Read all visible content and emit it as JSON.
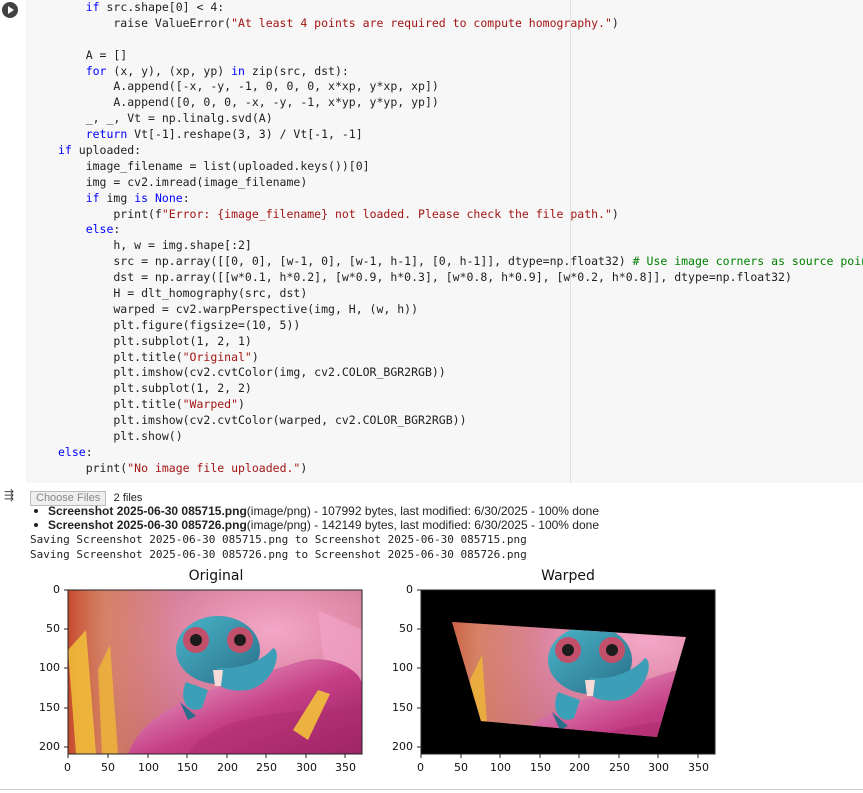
{
  "code_lines": [
    [
      [
        "    ",
        ""
      ],
      [
        "if",
        "k"
      ],
      [
        " src.shape[0] < 4:",
        ""
      ]
    ],
    [
      [
        "        raise ValueError(",
        ""
      ],
      [
        "\"At least 4 points are required to compute homography.\"",
        "s"
      ],
      [
        ")",
        ""
      ]
    ],
    [
      [
        "",
        ""
      ]
    ],
    [
      [
        "    A = []",
        ""
      ]
    ],
    [
      [
        "    ",
        ""
      ],
      [
        "for",
        "k"
      ],
      [
        " (x, y), (xp, yp) ",
        ""
      ],
      [
        "in",
        "k"
      ],
      [
        " zip(src, dst):",
        ""
      ]
    ],
    [
      [
        "        A.append([-x, -y, -1, 0, 0, 0, x*xp, y*xp, xp])",
        ""
      ]
    ],
    [
      [
        "        A.append([0, 0, 0, -x, -y, -1, x*yp, y*yp, yp])",
        ""
      ]
    ],
    [
      [
        "    _, _, Vt = np.linalg.svd(A)",
        ""
      ]
    ],
    [
      [
        "    ",
        ""
      ],
      [
        "return",
        "k"
      ],
      [
        " Vt[-1].reshape(3, 3) / Vt[-1, -1]",
        ""
      ]
    ],
    [
      [
        "if",
        "k"
      ],
      [
        " uploaded:",
        ""
      ]
    ],
    [
      [
        "    image_filename = list(uploaded.keys())[0]",
        ""
      ]
    ],
    [
      [
        "    img = cv2.imread(image_filename)",
        ""
      ]
    ],
    [
      [
        "    ",
        ""
      ],
      [
        "if",
        "k"
      ],
      [
        " img ",
        ""
      ],
      [
        "is",
        "k"
      ],
      [
        " ",
        ""
      ],
      [
        "None",
        "k"
      ],
      [
        ":",
        ""
      ]
    ],
    [
      [
        "        print(f",
        ""
      ],
      [
        "\"Error: {image_filename} not loaded. Please check the file path.\"",
        "s"
      ],
      [
        ")",
        ""
      ]
    ],
    [
      [
        "    ",
        ""
      ],
      [
        "else",
        "k"
      ],
      [
        ":",
        ""
      ]
    ],
    [
      [
        "        h, w = img.shape[:2]",
        ""
      ]
    ],
    [
      [
        "        src = np.array([[0, 0], [w-1, 0], [w-1, h-1], [0, h-1]], dtype=np.float32) ",
        ""
      ],
      [
        "# Use image corners as source points",
        "c"
      ]
    ],
    [
      [
        "        dst = np.array([[w*0.1, h*0.2], [w*0.9, h*0.3], [w*0.8, h*0.9], [w*0.2, h*0.8]], dtype=np.float32)",
        ""
      ]
    ],
    [
      [
        "        H = dlt_homography(src, dst)",
        ""
      ]
    ],
    [
      [
        "        warped = cv2.warpPerspective(img, H, (w, h))",
        ""
      ]
    ],
    [
      [
        "        plt.figure(figsize=(10, 5))",
        ""
      ]
    ],
    [
      [
        "        plt.subplot(1, 2, 1)",
        ""
      ]
    ],
    [
      [
        "        plt.title(",
        ""
      ],
      [
        "\"Original\"",
        "s"
      ],
      [
        ")",
        ""
      ]
    ],
    [
      [
        "        plt.imshow(cv2.cvtColor(img, cv2.COLOR_BGR2RGB))",
        ""
      ]
    ],
    [
      [
        "        plt.subplot(1, 2, 2)",
        ""
      ]
    ],
    [
      [
        "        plt.title(",
        ""
      ],
      [
        "\"Warped\"",
        "s"
      ],
      [
        ")",
        ""
      ]
    ],
    [
      [
        "        plt.imshow(cv2.cvtColor(warped, cv2.COLOR_BGR2RGB))",
        ""
      ]
    ],
    [
      [
        "        plt.show()",
        ""
      ]
    ],
    [
      [
        "else",
        "k"
      ],
      [
        ":",
        ""
      ]
    ],
    [
      [
        "    print(",
        ""
      ],
      [
        "\"No image file uploaded.\"",
        "s"
      ],
      [
        ")",
        ""
      ]
    ]
  ],
  "output": {
    "choose_files_label": "Choose Files",
    "files_count": "2 files",
    "files": [
      {
        "name": "Screenshot 2025-06-30 085715.png",
        "detail": "(image/png) - 107992 bytes, last modified: 6/30/2025 - 100% done"
      },
      {
        "name": "Screenshot 2025-06-30 085726.png",
        "detail": "(image/png) - 142149 bytes, last modified: 6/30/2025 - 100% done"
      }
    ],
    "saving_lines": [
      "Saving Screenshot 2025-06-30 085715.png to Screenshot 2025-06-30 085715.png",
      "Saving Screenshot 2025-06-30 085726.png to Screenshot 2025-06-30 085726.png"
    ]
  },
  "plots": {
    "original_title": "Original",
    "warped_title": "Warped",
    "x_ticks": [
      "0",
      "50",
      "100",
      "150",
      "200",
      "250",
      "300",
      "350"
    ],
    "y_ticks": [
      "0",
      "50",
      "100",
      "150",
      "200"
    ]
  },
  "colors": {
    "keyword": "#0000ff",
    "string": "#a31515",
    "comment": "#008000"
  }
}
